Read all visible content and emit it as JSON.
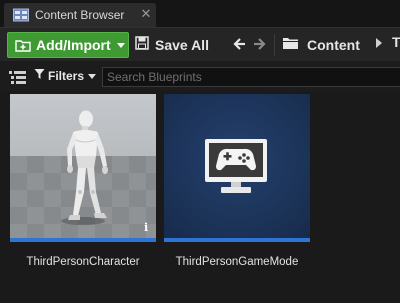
{
  "tab": {
    "title": "Content Browser"
  },
  "toolbar": {
    "add_import_label": "Add/Import",
    "save_all_label": "Save All",
    "breadcrumb_label": "Content",
    "breadcrumb_next": "T"
  },
  "filter_bar": {
    "filters_label": "Filters",
    "search_placeholder": "Search Blueprints"
  },
  "assets": [
    {
      "name": "ThirdPersonCharacter",
      "icon": "mannequin-thumbnail"
    },
    {
      "name": "ThirdPersonGameMode",
      "icon": "gamepad-monitor-icon"
    }
  ],
  "colors": {
    "accent_green": "#3f9a33",
    "asset_bar_blue": "#2e74d4",
    "gamemode_bg": "#1b3256"
  }
}
